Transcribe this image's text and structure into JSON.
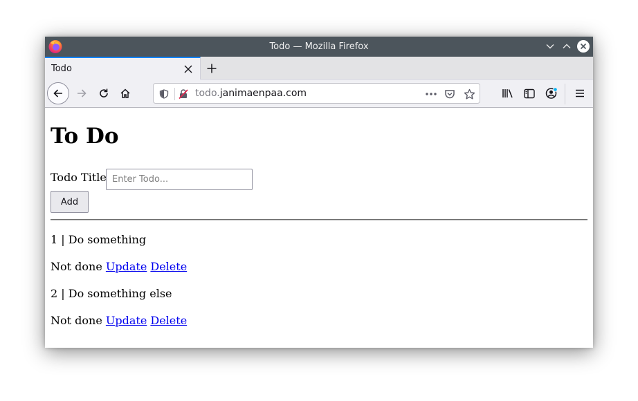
{
  "window": {
    "title": "Todo — Mozilla Firefox"
  },
  "tabs": [
    {
      "label": "Todo"
    }
  ],
  "urlbar": {
    "subdomain": "todo.",
    "domain": "janimaenpaa.com"
  },
  "page": {
    "heading": "To Do",
    "form": {
      "label": "Todo Title",
      "placeholder": "Enter Todo...",
      "value": "",
      "add_label": "Add"
    },
    "todos": [
      {
        "summary": "1 | Do something",
        "status": "Not done",
        "update_label": "Update",
        "delete_label": "Delete"
      },
      {
        "summary": "2 | Do something else",
        "status": "Not done",
        "update_label": "Update",
        "delete_label": "Delete"
      }
    ]
  },
  "colors": {
    "titlebar": "#4c555c",
    "tab_accent": "#0a84ff",
    "link": "#0000ee",
    "notification_dot": "#00b3f4"
  }
}
